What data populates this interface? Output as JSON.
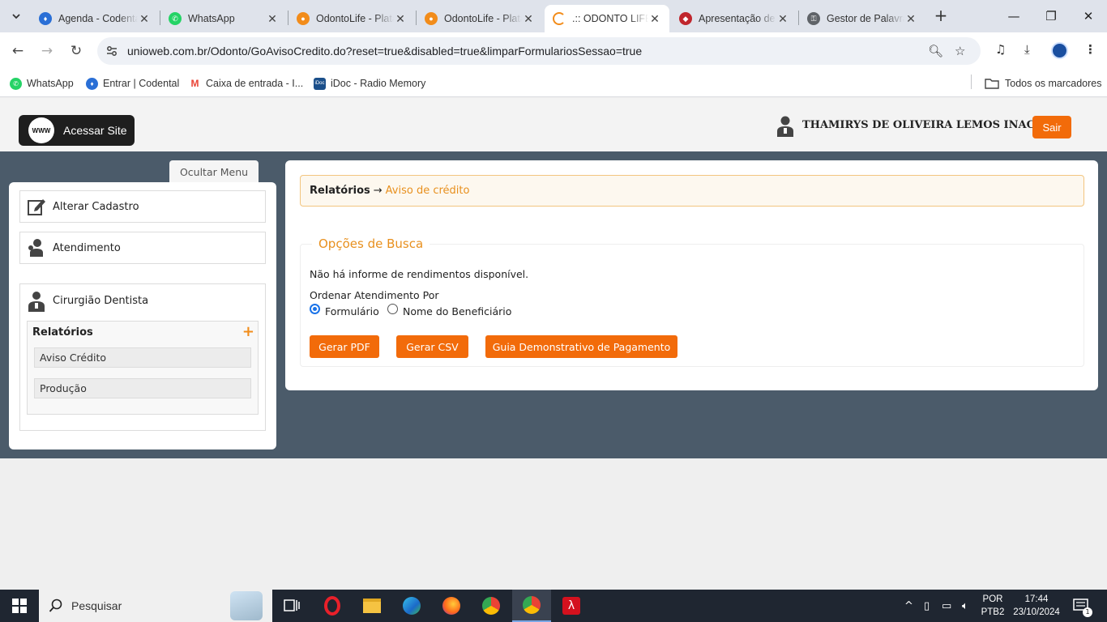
{
  "browser": {
    "tabs": [
      {
        "title": "Agenda - Codental",
        "icon": "codental-tooth-icon",
        "color": "#2a6fd6"
      },
      {
        "title": "WhatsApp",
        "icon": "whatsapp-icon",
        "color": "#25d366"
      },
      {
        "title": "OdontoLife - Plataforma",
        "icon": "odontolife-icon",
        "color": "#f28c1a"
      },
      {
        "title": "OdontoLife - Plataforma",
        "icon": "odontolife-icon",
        "color": "#f28c1a"
      },
      {
        "title": ".:: ODONTO LIFE",
        "icon": "loading-icon",
        "color": "#f28c1a"
      },
      {
        "title": "Apresentação de",
        "icon": "presentation-icon",
        "color": "#c0262d"
      },
      {
        "title": "Gestor de Palavras",
        "icon": "key-icon",
        "color": "#5f6368"
      }
    ],
    "active_tab_index": 4,
    "url": "unioweb.com.br/Odonto/GoAvisoCredito.do?reset=true&disabled=true&limparFormulariosSessao=true",
    "bookmarks": [
      {
        "label": "WhatsApp",
        "color": "#25d366"
      },
      {
        "label": "Entrar | Codental",
        "color": "#2a6fd6"
      },
      {
        "label": "Caixa de entrada - I...",
        "color": "#ea4335"
      },
      {
        "label": "iDoc - Radio Memory",
        "color": "#1b4f8a",
        "badge": "iDoc"
      }
    ],
    "all_bookmarks_label": "Todos os marcadores"
  },
  "header": {
    "site_button_label": "Acessar Site",
    "www_badge": "WWW",
    "user_name": "THAMIRYS DE OLIVEIRA LEMOS INACIO",
    "logout_label": "Sair"
  },
  "sidebar": {
    "toggle_label": "Ocultar Menu",
    "items": [
      {
        "label": "Alterar Cadastro",
        "icon": "edit-icon"
      },
      {
        "label": "Atendimento",
        "icon": "support-agent-icon"
      },
      {
        "label": "Cirurgião Dentista",
        "icon": "dentist-icon"
      }
    ],
    "submenu": {
      "title": "Relatórios",
      "items": [
        "Aviso Crédito",
        "Produção"
      ]
    }
  },
  "main": {
    "breadcrumb": {
      "parent": "Relatórios",
      "separator": "→",
      "current": "Aviso de crédito"
    },
    "search": {
      "legend": "Opções de Busca",
      "message": "Não há informe de rendimentos disponível.",
      "order_label": "Ordenar Atendimento Por",
      "options": [
        {
          "label": "Formulário",
          "checked": true
        },
        {
          "label": "Nome do Beneficiário",
          "checked": false
        }
      ],
      "buttons": [
        "Gerar PDF",
        "Gerar CSV",
        "Guia Demonstrativo de Pagamento"
      ]
    }
  },
  "taskbar": {
    "search_placeholder": "Pesquisar",
    "lang_line1": "POR",
    "lang_line2": "PTB2",
    "time": "17:44",
    "date": "23/10/2024",
    "notification_count": "1"
  },
  "colors": {
    "accent": "#f26b0a",
    "accent_text": "#e8901e",
    "band": "#4b5b6a"
  }
}
